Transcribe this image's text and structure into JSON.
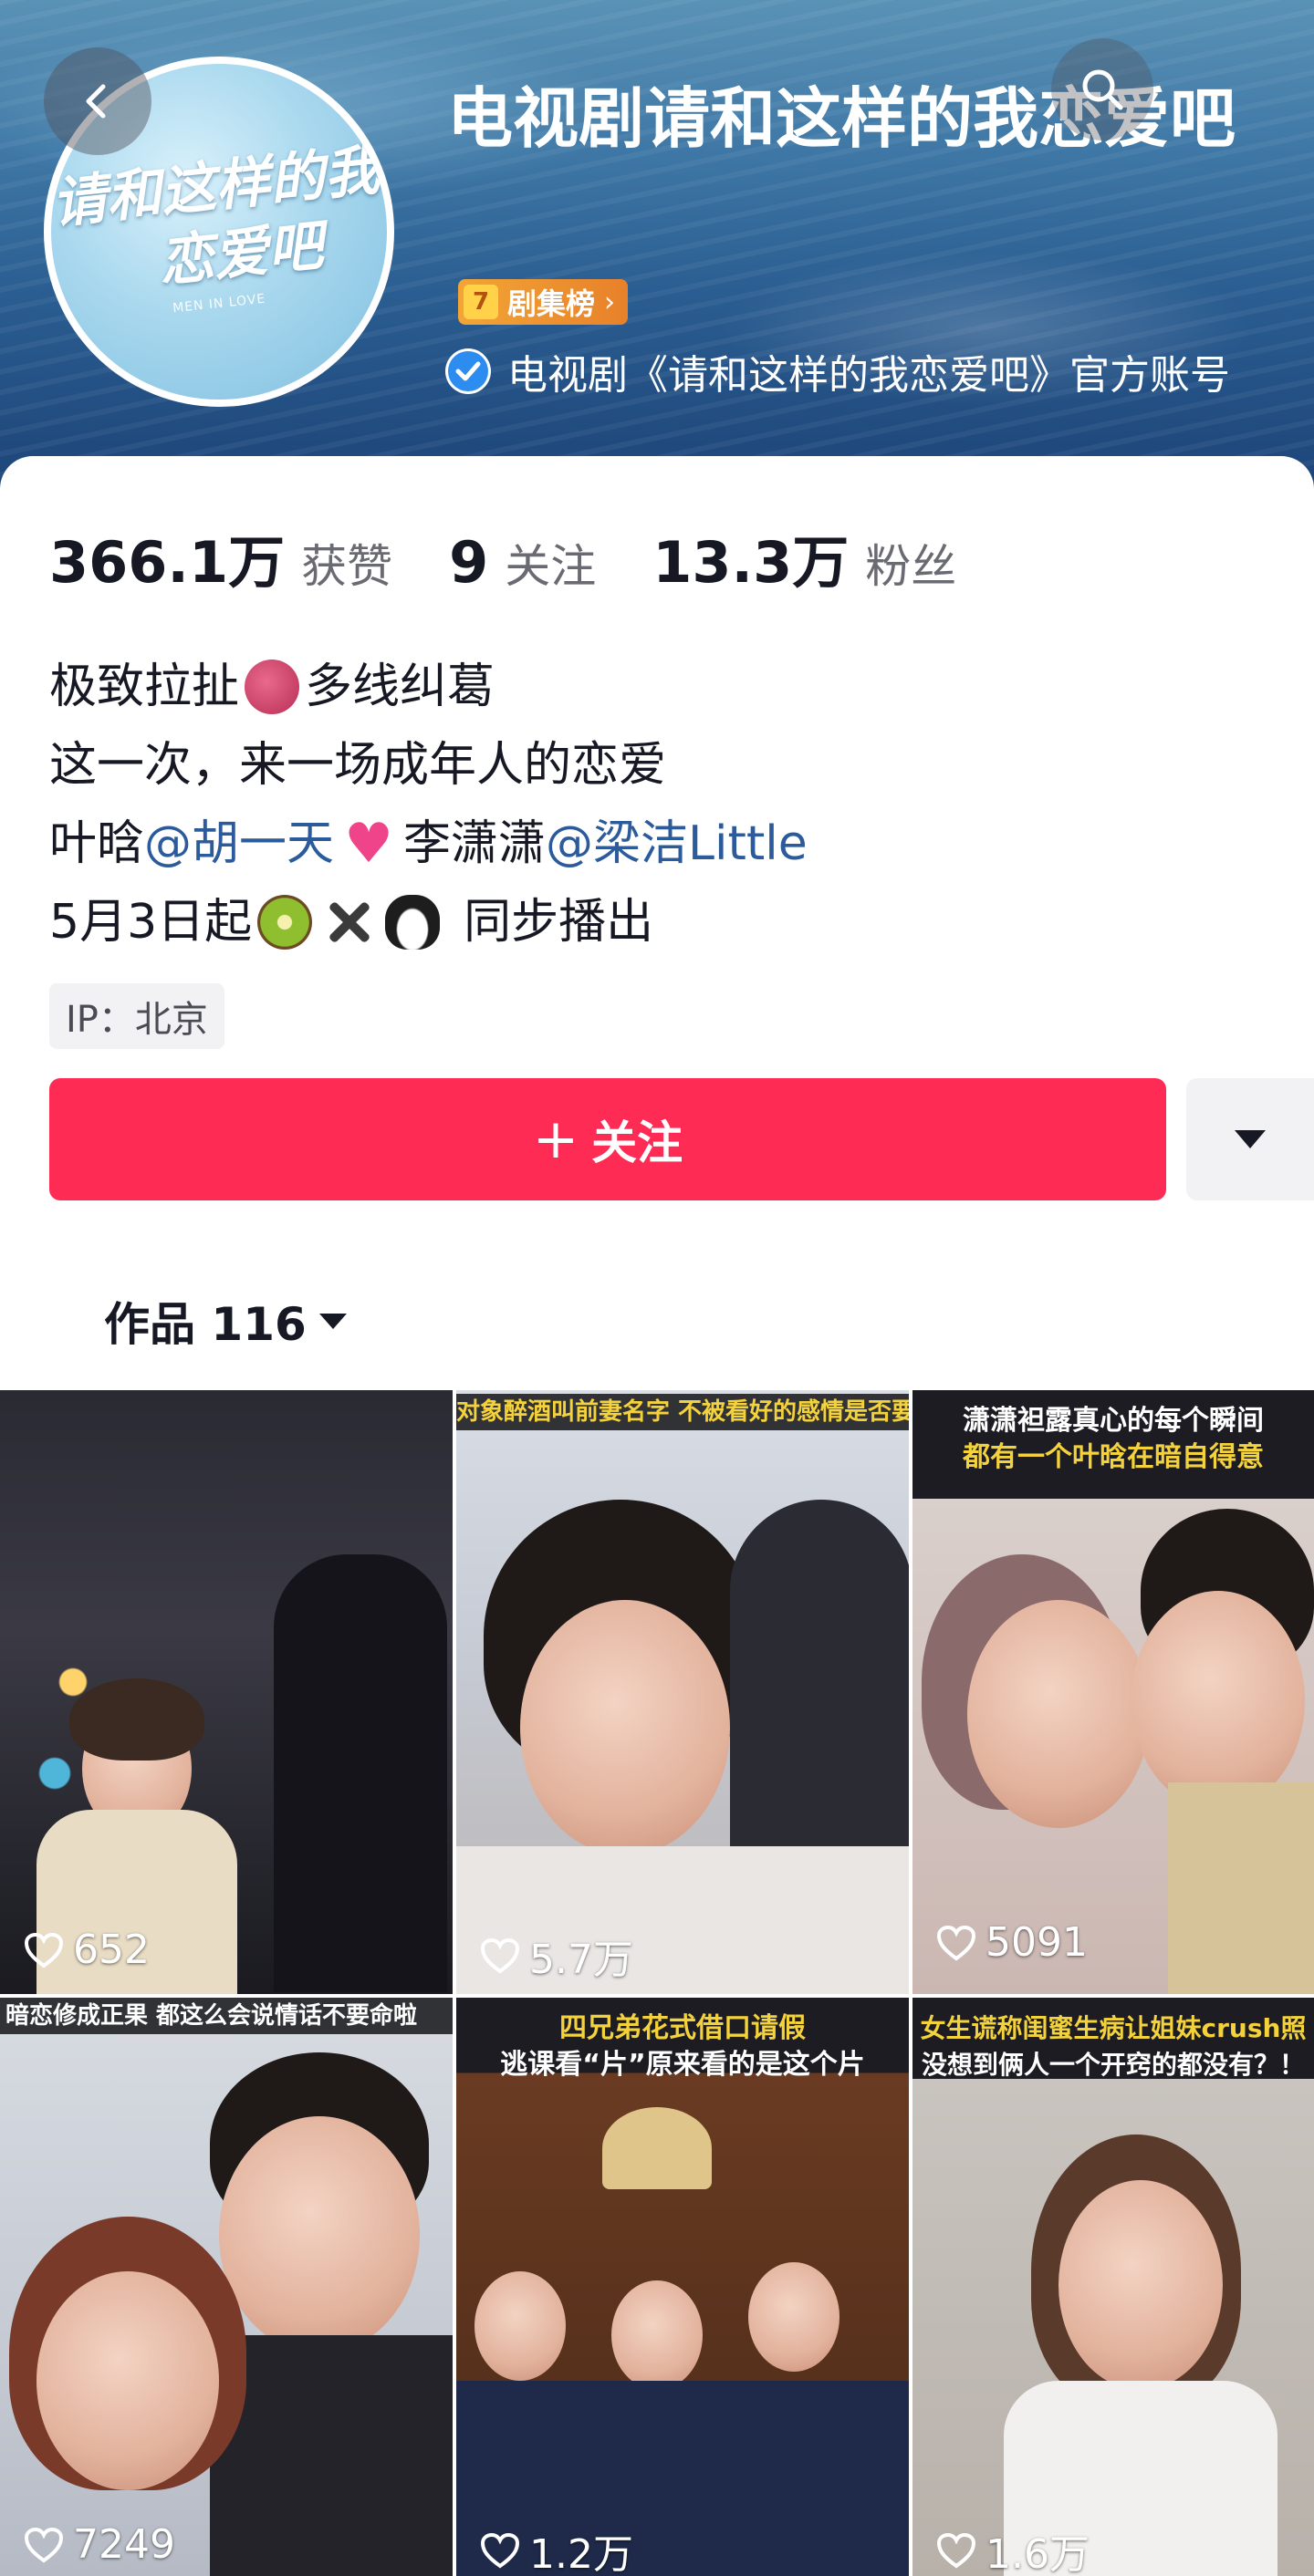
{
  "header": {
    "profile_name": "电视剧请和这样的我恋爱吧",
    "rank_number": "7",
    "rank_label": "剧集榜",
    "verified_text": "电视剧《请和这样的我恋爱吧》官方账号",
    "avatar_logo_line1": "请和这样的我",
    "avatar_logo_line2": "恋爱吧",
    "avatar_subtitle": "MEN IN LOVE"
  },
  "stats": {
    "likes_value": "366.1万",
    "likes_label": "获赞",
    "following_value": "9",
    "following_label": "关注",
    "followers_value": "13.3万",
    "followers_label": "粉丝"
  },
  "bio": {
    "line1_a": "极致拉扯",
    "line1_b": "多线纠葛",
    "line2": "这一次，来一场成年人的恋爱",
    "line3_a": "叶晗",
    "line3_mention1": "@胡一天",
    "line3_b": "李潇潇",
    "line3_mention2": "@梁洁Little",
    "line4_a": "5月3日起",
    "line4_b": "同步播出"
  },
  "ip_tag": "IP：北京",
  "follow_button": {
    "plus": "+",
    "label": "关注"
  },
  "works_tab": {
    "label": "作品 116"
  },
  "videos": [
    {
      "caption1": "",
      "caption2": "",
      "likes": "652"
    },
    {
      "caption1": "对象醉酒叫前妻名字 不被看好的感情是否要继",
      "caption2": "",
      "likes": "5.7万"
    },
    {
      "caption1": "潇潇袒露真心的每个瞬间",
      "caption2": "都有一个叶晗在暗自得意",
      "likes": "5091"
    },
    {
      "caption1": "暗恋修成正果 都这么会说情话不要命啦",
      "caption2": "",
      "likes": "7249"
    },
    {
      "caption1": "四兄弟花式借口请假",
      "caption2": "逃课看“片”原来看的是这个片",
      "likes": "1.2万"
    },
    {
      "caption1": "女生谎称闺蜜生病让姐妹crush照",
      "caption2": "没想到俩人一个开窍的都没有？！",
      "likes": "1.6万"
    }
  ],
  "colors": {
    "follow_button": "#fe2c55",
    "mention": "#2c5b9c",
    "header_blue": "#2a5d91",
    "caption_yellow": "#f4d23c",
    "caption_white": "#ffffff"
  },
  "icons": [
    "back-arrow-icon",
    "search-icon",
    "verified-check-icon",
    "chevron-right-icon",
    "caret-down-icon",
    "heart-outline-icon"
  ]
}
